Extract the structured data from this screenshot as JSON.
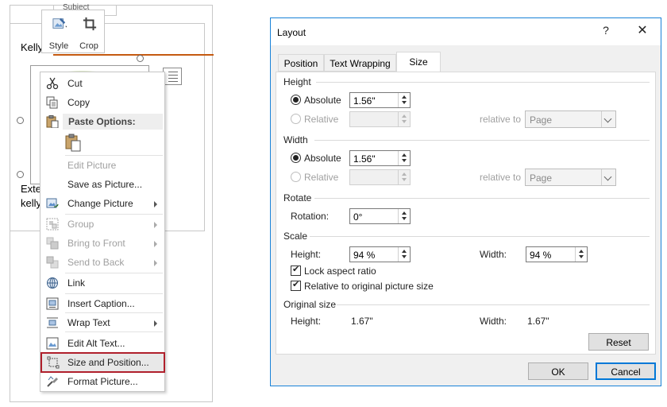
{
  "document": {
    "subject_label": "Subject",
    "text_line1": "Kelly",
    "text_line2": "Exte",
    "text_line3": "kelly"
  },
  "mini_toolbar": {
    "style_label": "Style",
    "crop_label": "Crop"
  },
  "context_menu": {
    "cut": "Cut",
    "copy": "Copy",
    "paste_options": "Paste Options:",
    "edit_picture": "Edit Picture",
    "save_as_picture": "Save as Picture...",
    "change_picture": "Change Picture",
    "group": "Group",
    "bring_to_front": "Bring to Front",
    "send_to_back": "Send to Back",
    "link": "Link",
    "insert_caption": "Insert Caption...",
    "wrap_text": "Wrap Text",
    "edit_alt_text": "Edit Alt Text...",
    "size_and_position": "Size and Position...",
    "format_picture": "Format Picture..."
  },
  "dialog": {
    "title": "Layout",
    "help": "?",
    "close": "✕",
    "tabs": [
      "Position",
      "Text Wrapping",
      "Size"
    ],
    "active_tab": "Size",
    "height": {
      "section": "Height",
      "absolute_label": "Absolute",
      "absolute_value": "1.56\"",
      "relative_label": "Relative",
      "relative_value": "",
      "relative_to_label": "relative to",
      "relative_to_value": "Page"
    },
    "width": {
      "section": "Width",
      "absolute_label": "Absolute",
      "absolute_value": "1.56\"",
      "relative_label": "Relative",
      "relative_value": "",
      "relative_to_label": "relative to",
      "relative_to_value": "Page"
    },
    "rotate": {
      "section": "Rotate",
      "rotation_label": "Rotation:",
      "rotation_value": "0°"
    },
    "scale": {
      "section": "Scale",
      "height_label": "Height:",
      "height_value": "94 %",
      "width_label": "Width:",
      "width_value": "94 %",
      "lock_aspect_label": "Lock aspect ratio",
      "lock_aspect_checked": true,
      "relative_original_label": "Relative to original picture size",
      "relative_original_checked": true
    },
    "original_size": {
      "section": "Original size",
      "height_label": "Height:",
      "height_value": "1.67\"",
      "width_label": "Width:",
      "width_value": "1.67\""
    },
    "reset_label": "Reset",
    "ok_label": "OK",
    "cancel_label": "Cancel"
  }
}
